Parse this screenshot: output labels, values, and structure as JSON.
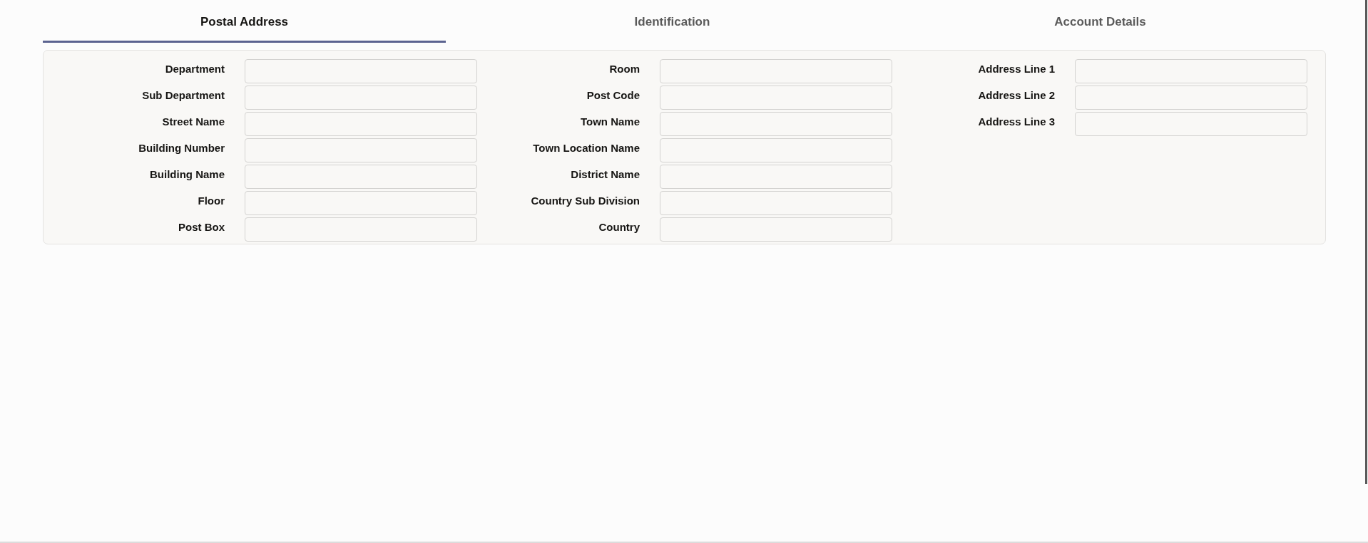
{
  "tabs": [
    {
      "label": "Postal Address",
      "selected": true
    },
    {
      "label": "Identification",
      "selected": false
    },
    {
      "label": "Account Details",
      "selected": false
    }
  ],
  "columns": [
    {
      "fields": [
        {
          "label": "Department"
        },
        {
          "label": "Sub Department"
        },
        {
          "label": "Street Name"
        },
        {
          "label": "Building Number"
        },
        {
          "label": "Building Name"
        },
        {
          "label": "Floor"
        },
        {
          "label": "Post Box"
        }
      ]
    },
    {
      "fields": [
        {
          "label": "Room"
        },
        {
          "label": "Post Code"
        },
        {
          "label": "Town Name"
        },
        {
          "label": "Town Location Name"
        },
        {
          "label": "District Name"
        },
        {
          "label": "Country Sub Division"
        },
        {
          "label": "Country"
        }
      ]
    },
    {
      "fields": [
        {
          "label": "Address Line 1"
        },
        {
          "label": "Address Line 2"
        },
        {
          "label": "Address Line 3"
        }
      ]
    }
  ]
}
